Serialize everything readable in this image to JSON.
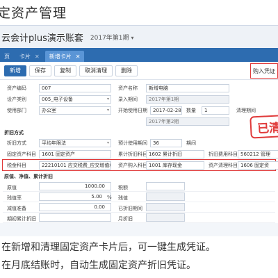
{
  "heading": "定资产管理",
  "app": {
    "name": "云会计plus演示账套",
    "period": "2017年第1期"
  },
  "tabs": [
    {
      "label": "页",
      "active": false
    },
    {
      "label": "卡片",
      "active": false
    },
    {
      "label": "新增卡片",
      "active": true
    }
  ],
  "toolbar": {
    "new": "新增",
    "save": "保存",
    "copy": "复制",
    "cancel_clear": "取消清理",
    "delete": "删除",
    "voucher": "购入凭证"
  },
  "stamp": "已清",
  "basic": {
    "asset_code_label": "资产编码",
    "asset_code": "007",
    "asset_name_label": "资产名称",
    "asset_name": "新增电脑",
    "category_label": "设产类别",
    "category": "005_电子设备",
    "entry_period_label": "录入期间",
    "entry_period": "2017年第1期",
    "dept_label": "使用部门",
    "dept": "办公室",
    "start_date_label": "开始使用日期",
    "start_date": "2017-02-28",
    "quantity_label": "数量",
    "quantity": "1",
    "clear_period_label": "清理期间",
    "clear_period": "2017年第2期"
  },
  "depreciation": {
    "section": "折旧方式",
    "method_label": "折旧方式",
    "method": "平均年限法",
    "months_label": "预计使用期间",
    "months": "36",
    "unit_label": "期间",
    "fixed_account_label": "固定资产科目",
    "fixed_account": "1601 固定资产",
    "accum_account_label": "累计折旧科目",
    "accum_account": "1602 累计折旧",
    "expense_account_label": "折旧费用科目",
    "expense_account": "560212 管理",
    "tax_account_label": "税金科目",
    "tax_account": "22210101 应交税费_应交增值税_进项",
    "offset_account_label": "资产购入科目",
    "offset_account": "1001 库存现金",
    "clear_account_label": "资产清理科目",
    "clear_account": "1606 固定资"
  },
  "values": {
    "section": "原值、净值、累计折旧",
    "original_label": "原值",
    "original": "1000.00",
    "tax_label": "税额",
    "tax": "",
    "residual_rate_label": "残值率",
    "residual_rate": "5.00",
    "percent": "%",
    "residual_label": "残值",
    "residual": "",
    "impairment_label": "减值准备",
    "impairment": "0.00",
    "used_label": "已折旧期间",
    "used": "",
    "init_dep_label": "期初累计折旧",
    "init_dep": "",
    "monthly_label": "月折旧",
    "monthly": ""
  },
  "captions": [
    "在新增和清理固定资产卡片后，可一键生成凭证。",
    "在月底结账时，自动生成固定资产折旧凭证。"
  ]
}
